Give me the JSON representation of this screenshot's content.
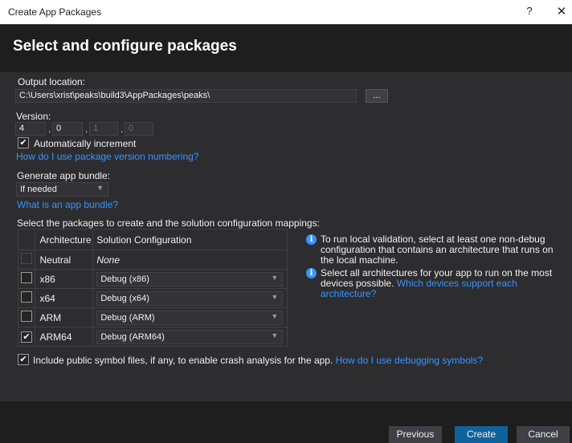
{
  "window": {
    "title": "Create App Packages",
    "help_glyph": "?",
    "close_glyph": "✕"
  },
  "header": {
    "title": "Select and configure packages"
  },
  "output": {
    "label": "Output location:",
    "path": "C:\\Users\\xrist\\peaks\\build3\\AppPackages\\peaks\\",
    "browse_label": "..."
  },
  "version": {
    "label": "Version:",
    "parts": [
      "4",
      "0",
      "1",
      "0"
    ],
    "separator": ".",
    "auto_increment_label": "Automatically increment",
    "auto_increment_checked": true,
    "help_link": "How do I use package version numbering?"
  },
  "bundle": {
    "label": "Generate app bundle:",
    "selected": "If needed",
    "help_link": "What is an app bundle?"
  },
  "packages": {
    "label": "Select the packages to create and the solution configuration mappings:",
    "columns": [
      "Architecture",
      "Solution Configuration"
    ],
    "rows": [
      {
        "arch": "Neutral",
        "config": "None",
        "checked": false,
        "enabled": false
      },
      {
        "arch": "x86",
        "config": "Debug (x86)",
        "checked": false,
        "enabled": true
      },
      {
        "arch": "x64",
        "config": "Debug (x64)",
        "checked": false,
        "enabled": true
      },
      {
        "arch": "ARM",
        "config": "Debug (ARM)",
        "checked": false,
        "enabled": true
      },
      {
        "arch": "ARM64",
        "config": "Debug (ARM64)",
        "checked": true,
        "enabled": true
      }
    ]
  },
  "info": {
    "item1": "To run local validation, select at least one non-debug configuration that contains an architecture that runs on the local machine.",
    "item2_text": "Select all architectures for your app to run on the most devices possible.",
    "item2_link": "Which devices support each architecture?"
  },
  "symbols": {
    "label": "Include public symbol files, if any, to enable crash analysis for the app.",
    "link": "How do I use debugging symbols?",
    "checked": true
  },
  "buttons": {
    "previous": "Previous",
    "create": "Create",
    "cancel": "Cancel"
  },
  "colors": {
    "background": "#2d2d30",
    "header": "#1e1e1e",
    "accent": "#3794ff",
    "primary_button": "#0e639c"
  },
  "icons": {
    "info": "info-icon",
    "check": "check-icon",
    "dropdown": "chevron-down-icon"
  }
}
